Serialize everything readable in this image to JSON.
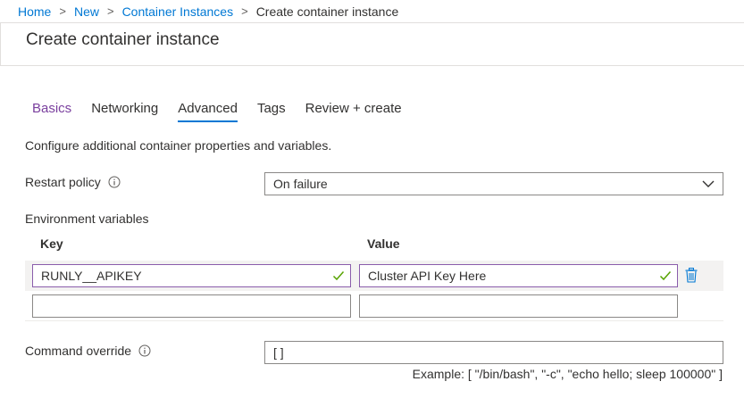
{
  "breadcrumb": {
    "items": [
      "Home",
      "New",
      "Container Instances"
    ],
    "current": "Create container instance",
    "separator": ">"
  },
  "page": {
    "title": "Create container instance"
  },
  "tabs": [
    {
      "label": "Basics",
      "state": "visited"
    },
    {
      "label": "Networking",
      "state": "normal"
    },
    {
      "label": "Advanced",
      "state": "active"
    },
    {
      "label": "Tags",
      "state": "normal"
    },
    {
      "label": "Review + create",
      "state": "normal"
    }
  ],
  "description": "Configure additional container properties and variables.",
  "restart_policy": {
    "label": "Restart policy",
    "value": "On failure",
    "icon": "info-icon"
  },
  "env": {
    "label": "Environment variables",
    "key_header": "Key",
    "value_header": "Value",
    "rows": [
      {
        "key": "RUNLY__APIKEY",
        "value": "Cluster API Key Here"
      },
      {
        "key": "",
        "value": ""
      }
    ]
  },
  "command_override": {
    "label": "Command override",
    "value": "[ ]",
    "example": "Example: [ \"/bin/bash\", \"-c\", \"echo hello; sleep 100000\" ]",
    "icon": "info-icon"
  },
  "colors": {
    "link": "#0078d4",
    "visited_tab": "#7a3f9e",
    "active_tab_underline": "#0078d4",
    "valid_border": "#8a5dab",
    "valid_check": "#57a300",
    "trash": "#0078d4"
  }
}
